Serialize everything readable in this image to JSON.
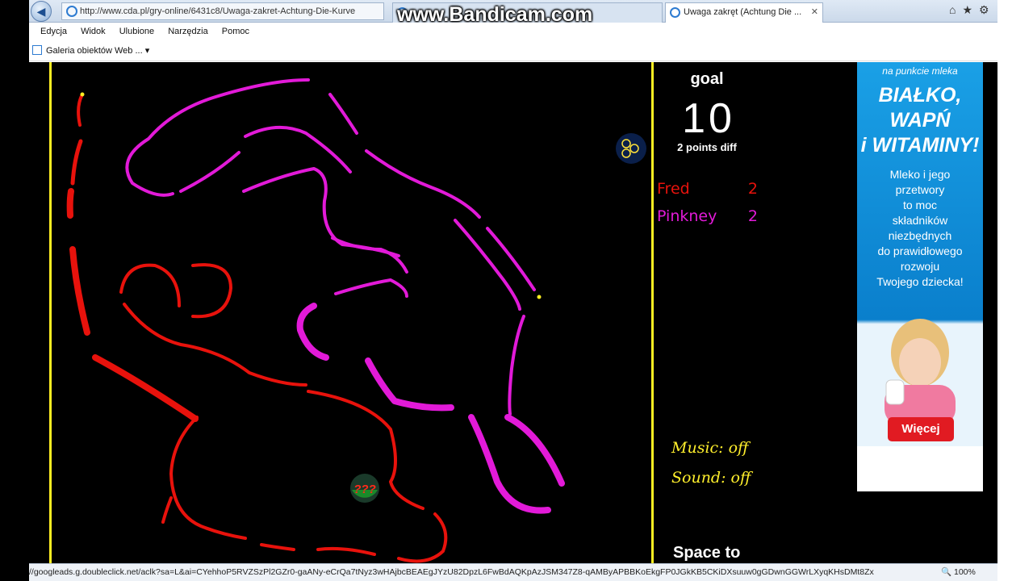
{
  "browser": {
    "address": "http://www.cda.pl/gry-online/6431c8/Uwaga-zakret-Achtung-Die-Kurve",
    "tabs": [
      {
        "label": "Uwaga zakręt (Achtung Die ..."
      }
    ],
    "tab_close": "✕",
    "menu": [
      "Edycja",
      "Widok",
      "Ulubione",
      "Narzędzia",
      "Pomoc"
    ],
    "favorites_item": "Galeria obiektów Web ...",
    "status_url": "//googleads.g.doubleclick.net/aclk?sa=L&ai=CYehhoP5RVZSzPl2GZr0-gaANy-eCrQa7tNyz3wHAjbcBEAEgJYzU82DpzL6FwBdAQKpAzJSM347Z8-qAMByAPBBKoEkgFP0JGkKB5CKiDXsuuw0gGDwnGGWrLXyqKHsDMt8Zx",
    "zoom": "100%",
    "icons": [
      "back-icon",
      "forward-icon",
      "home-icon",
      "star-icon",
      "gear-icon"
    ]
  },
  "watermark": "www.Bandicam.com",
  "game": {
    "goal_label": "goal",
    "goal_value": "10",
    "goal_diff": "2 points diff",
    "players": [
      {
        "name": "Fred",
        "score": "2",
        "color": "#e8120c"
      },
      {
        "name": "Pinkney",
        "score": "2",
        "color": "#e21ad8"
      }
    ],
    "music": "Music:  off",
    "sound": "Sound: off",
    "space_hint": "Space to",
    "powerups": [
      "extra-holes-icon",
      "random-bonus-icon"
    ],
    "random_bonus_text": "???",
    "border_color": "#ffee22"
  },
  "ad": {
    "top": "na punkcie mleka",
    "headline": [
      "BIAŁKO,",
      "WAPŃ",
      "i WITAMINY!"
    ],
    "body": [
      "Mleko i jego",
      "przetwory",
      "to moc",
      "składników",
      "niezbędnych",
      "do prawidłowego",
      "rozwoju",
      "Twojego dziecka!"
    ],
    "button": "Więcej"
  }
}
